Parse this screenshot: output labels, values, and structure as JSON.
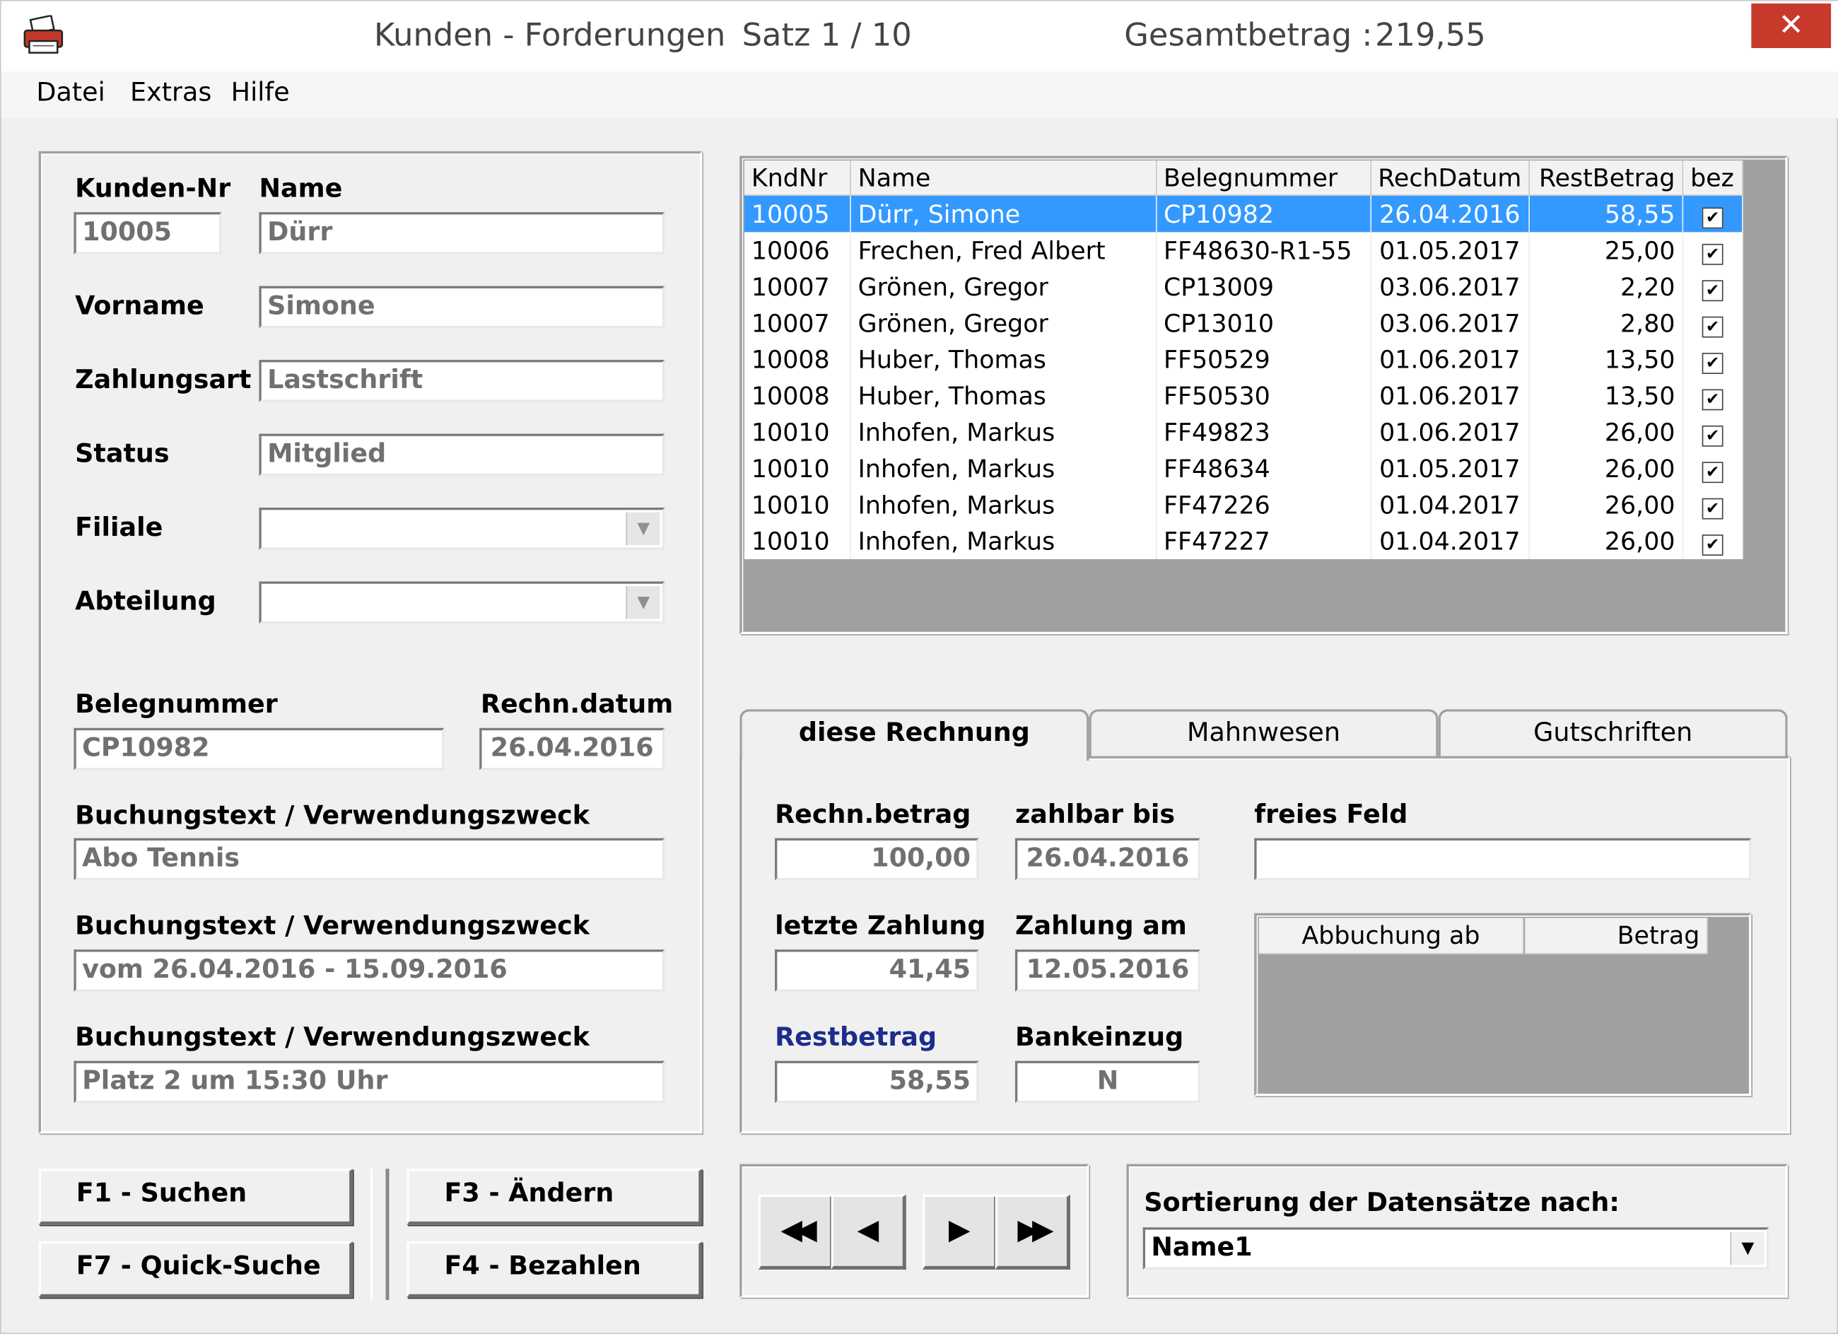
{
  "window": {
    "title": "Kunden - Forderungen",
    "record": "Satz 1 / 10",
    "total_label": "Gesamtbetrag :",
    "total_value": "219,55",
    "close_glyph": "✕",
    "app_icon": "printer-icon"
  },
  "menu": [
    "Datei",
    "Extras",
    "Hilfe"
  ],
  "customer": {
    "kunden_nr_label": "Kunden-Nr",
    "kunden_nr": "10005",
    "name_label": "Name",
    "name": "Dürr",
    "vorname_label": "Vorname",
    "vorname": "Simone",
    "zahlungsart_label": "Zahlungsart",
    "zahlungsart": "Lastschrift",
    "status_label": "Status",
    "status": "Mitglied",
    "filiale_label": "Filiale",
    "filiale": "",
    "abteilung_label": "Abteilung",
    "abteilung": "",
    "belegnummer_label": "Belegnummer",
    "belegnummer": "CP10982",
    "rechn_datum_label": "Rechn.datum",
    "rechn_datum": "26.04.2016",
    "buchungstext_label": "Buchungstext / Verwendungszweck",
    "buchungstext1": "Abo Tennis",
    "buchungstext2": "vom 26.04.2016 - 15.09.2016",
    "buchungstext3": "Platz 2  um 15:30 Uhr"
  },
  "grid": {
    "columns": [
      "KndNr",
      "Name",
      "Belegnummer",
      "RechDatum",
      "RestBetrag",
      "bez"
    ],
    "rows": [
      [
        "10005",
        "Dürr, Simone",
        "CP10982",
        "26.04.2016",
        "58,55",
        "✔"
      ],
      [
        "10006",
        "Frechen, Fred Albert",
        "FF48630-R1-55",
        "01.05.2017",
        "25,00",
        "✔"
      ],
      [
        "10007",
        "Grönen, Gregor",
        "CP13009",
        "03.06.2017",
        "2,20",
        "✔"
      ],
      [
        "10007",
        "Grönen, Gregor",
        "CP13010",
        "03.06.2017",
        "2,80",
        "✔"
      ],
      [
        "10008",
        "Huber, Thomas",
        "FF50529",
        "01.06.2017",
        "13,50",
        "✔"
      ],
      [
        "10008",
        "Huber, Thomas",
        "FF50530",
        "01.06.2017",
        "13,50",
        "✔"
      ],
      [
        "10010",
        "Inhofen, Markus",
        "FF49823",
        "01.06.2017",
        "26,00",
        "✔"
      ],
      [
        "10010",
        "Inhofen, Markus",
        "FF48634",
        "01.05.2017",
        "26,00",
        "✔"
      ],
      [
        "10010",
        "Inhofen, Markus",
        "FF47226",
        "01.04.2017",
        "26,00",
        "✔"
      ],
      [
        "10010",
        "Inhofen, Markus",
        "FF47227",
        "01.04.2017",
        "26,00",
        "✔"
      ]
    ]
  },
  "tabs": [
    "diese Rechnung",
    "Mahnwesen",
    "Gutschriften"
  ],
  "invoice": {
    "rechn_betrag_label": "Rechn.betrag",
    "rechn_betrag": "100,00",
    "zahlbar_bis_label": "zahlbar bis",
    "zahlbar_bis": "26.04.2016",
    "freies_feld_label": "freies Feld",
    "freies_feld": "",
    "letzte_zahlung_label": "letzte Zahlung",
    "letzte_zahlung": "41,45",
    "zahlung_am_label": "Zahlung am",
    "zahlung_am": "12.05.2016",
    "restbetrag_label": "Restbetrag",
    "restbetrag": "58,55",
    "bankeinzug_label": "Bankeinzug",
    "bankeinzug": "N",
    "subgrid_columns": [
      "Abbuchung ab",
      "Betrag"
    ]
  },
  "buttons": {
    "suchen": "F1 - Suchen",
    "quick_suche": "F7 - Quick-Suche",
    "aendern": "F3 - Ändern",
    "bezahlen": "F4 - Bezahlen"
  },
  "nav": {
    "first": "◀◀",
    "prev": "◀",
    "next": "▶",
    "last": "▶▶"
  },
  "sort": {
    "label": "Sortierung der Datensätze nach:",
    "value": "Name1",
    "arrow": "▼"
  },
  "colors": {
    "selection": "#3399ff",
    "restbetrag_label": "#1c2d8c",
    "close_button": "#c7392b"
  }
}
